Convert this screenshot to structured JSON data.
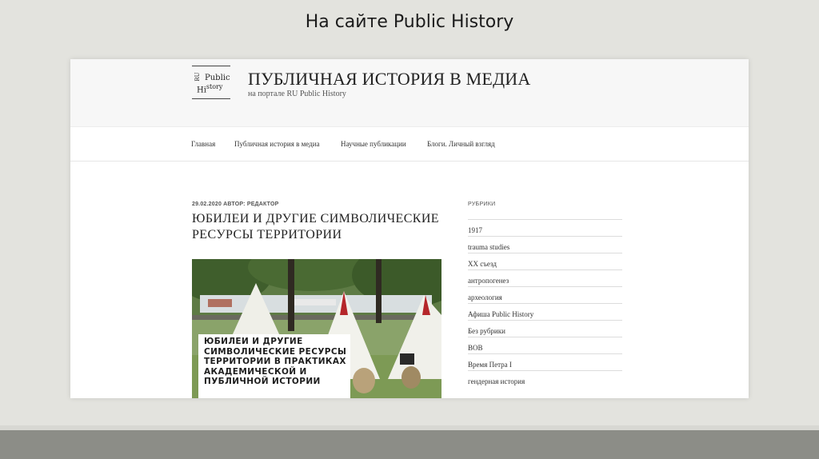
{
  "slide": {
    "title": "На сайте Public History"
  },
  "site": {
    "logo": {
      "ru": "RU",
      "line1": "Public",
      "line2_prefix": "Hi",
      "line2_suffix": "story"
    },
    "title": "ПУБЛИЧНАЯ ИСТОРИЯ В МЕДИА",
    "subtitle": "на портале RU Public History"
  },
  "nav": {
    "items": [
      {
        "label": "Главная"
      },
      {
        "label": "Публичная история в медиа"
      },
      {
        "label": "Научные публикации"
      },
      {
        "label": "Блоги. Личный взгляд"
      }
    ]
  },
  "post": {
    "meta": "29.02.2020 АВТОР: РЕДАКТОР",
    "title": "ЮБИЛЕИ И ДРУГИЕ СИМВОЛИЧЕСКИЕ РЕСУРСЫ ТЕРРИТОРИИ",
    "image_caption": "ЮБИЛЕИ И ДРУГИЕ СИМВОЛИЧЕСКИЕ РЕСУРСЫ ТЕРРИТОРИИ В ПРАКТИКАХ АКАДЕМИЧЕСКОЙ И ПУБЛИЧНОЙ ИСТОРИИ"
  },
  "sidebar": {
    "heading": "РУБРИКИ",
    "items": [
      {
        "label": "1917"
      },
      {
        "label": "trauma studies"
      },
      {
        "label": "XX съезд"
      },
      {
        "label": "антропогенез"
      },
      {
        "label": "археология"
      },
      {
        "label": "Афиша Public History"
      },
      {
        "label": "Без рубрики"
      },
      {
        "label": "ВОВ"
      },
      {
        "label": "Время Петра I"
      },
      {
        "label": "гендерная история"
      }
    ]
  }
}
